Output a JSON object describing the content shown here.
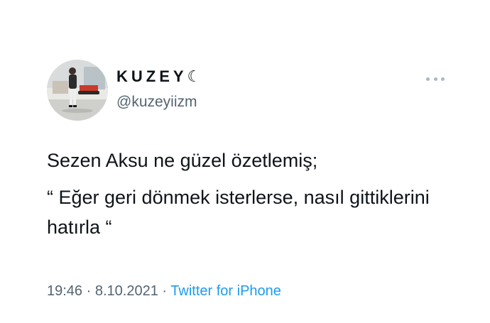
{
  "user": {
    "display_name": "KUZEY☾",
    "handle": "@kuzeyiizm",
    "avatar_icon": "profile-photo"
  },
  "tweet": {
    "lines": [
      "Sezen Aksu ne güzel özetlemiş;",
      "“ Eğer geri dönmek isterlerse, nasıl gittiklerini hatırla “"
    ],
    "time": "19:46",
    "separator_1": "·",
    "date": "8.10.2021",
    "separator_2": "·",
    "source": "Twitter for iPhone"
  },
  "menu": {
    "icon": "more-icon"
  },
  "colors": {
    "text": "#0f1419",
    "secondary": "#536471",
    "link": "#1d9bf0"
  }
}
